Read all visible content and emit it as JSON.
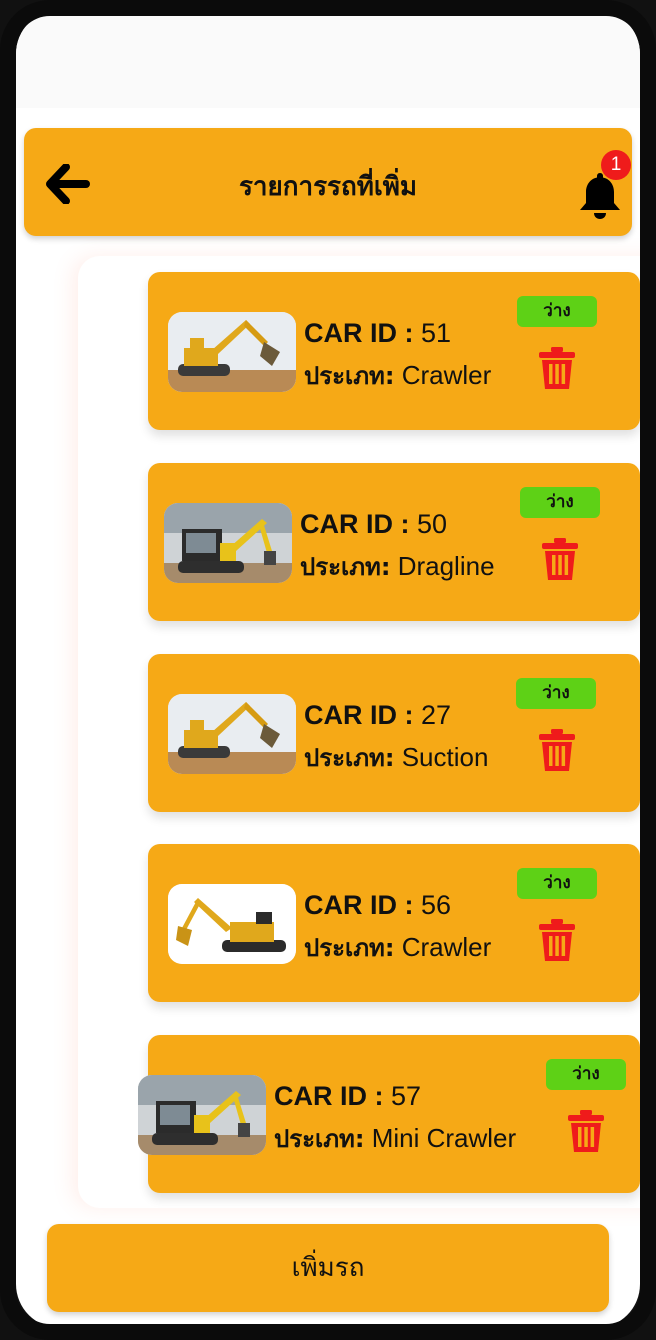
{
  "header": {
    "title": "รายการรถที่เพิ่ม",
    "notification_count": "1"
  },
  "labels": {
    "car_id": "CAR ID :",
    "type": "ประเภท:"
  },
  "cars": [
    {
      "id": "51",
      "type": "Crawler",
      "status": "ว่าง",
      "image": "yellow-excavator-photo"
    },
    {
      "id": "50",
      "type": "Dragline",
      "status": "ว่าง",
      "image": "mini-excavator-photo"
    },
    {
      "id": "27",
      "type": "Suction",
      "status": "ว่าง",
      "image": "yellow-excavator-photo"
    },
    {
      "id": "56",
      "type": "Crawler",
      "status": "ว่าง",
      "image": "excavator-white-background-photo"
    },
    {
      "id": "57",
      "type": "Mini Crawler",
      "status": "ว่าง",
      "image": "mini-excavator-photo"
    }
  ],
  "add_button": {
    "label": "เพิ่มรถ"
  },
  "colors": {
    "accent": "#f6a916",
    "status_green": "#5ed116",
    "delete_red": "#ef1b1b",
    "badge_red": "#ef1b1b"
  },
  "icons": [
    "arrow-left-icon",
    "bell-icon",
    "trash-icon"
  ]
}
